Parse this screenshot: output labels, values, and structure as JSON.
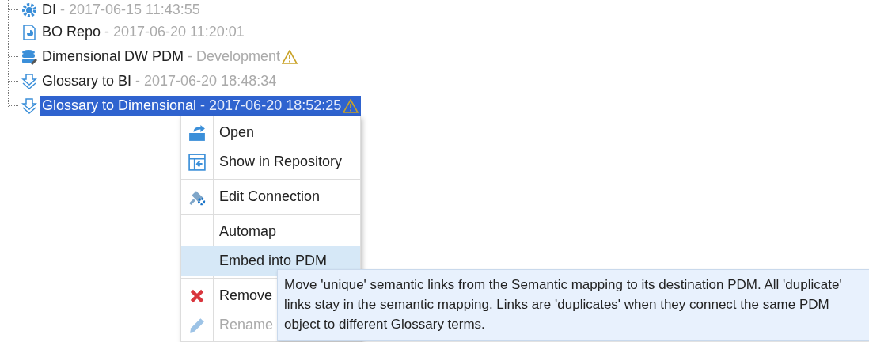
{
  "tree": {
    "items": [
      {
        "kind": "gear",
        "name": "DI",
        "detail": "- 2017-06-15 11:43:55",
        "warning": false,
        "selected": false
      },
      {
        "kind": "report",
        "name": "BO Repo",
        "detail": "- 2017-06-20 11:20:01",
        "warning": false,
        "selected": false
      },
      {
        "kind": "database",
        "name": "Dimensional DW PDM",
        "detail": "- Development",
        "warning": true,
        "selected": false
      },
      {
        "kind": "mapping",
        "name": "Glossary to BI",
        "detail": "- 2017-06-20 18:48:34",
        "warning": false,
        "selected": false
      },
      {
        "kind": "mapping",
        "name": "Glossary to Dimensional",
        "detail": "- 2017-06-20 18:52:25",
        "warning": true,
        "selected": true
      }
    ]
  },
  "context_menu": {
    "groups": [
      [
        {
          "kind": "open",
          "label": "Open",
          "selected": false,
          "disabled": false
        },
        {
          "kind": "repository",
          "label": "Show in Repository",
          "selected": false,
          "disabled": false
        }
      ],
      [
        {
          "kind": "connection",
          "label": "Edit Connection",
          "selected": false,
          "disabled": false
        }
      ],
      [
        {
          "kind": "plain",
          "label": "Automap",
          "selected": false,
          "disabled": false
        },
        {
          "kind": "plain",
          "label": "Embed into PDM",
          "selected": true,
          "disabled": false
        }
      ],
      [
        {
          "kind": "remove",
          "label": "Remove",
          "selected": false,
          "disabled": false
        },
        {
          "kind": "rename",
          "label": "Rename",
          "selected": false,
          "disabled": true
        }
      ]
    ]
  },
  "tooltip": {
    "text": "Move 'unique' semantic links from the Semantic mapping to its destination PDM. All 'duplicate' links stay in the semantic mapping. Links are 'duplicates' when they connect the same PDM object to different Glossary terms."
  }
}
